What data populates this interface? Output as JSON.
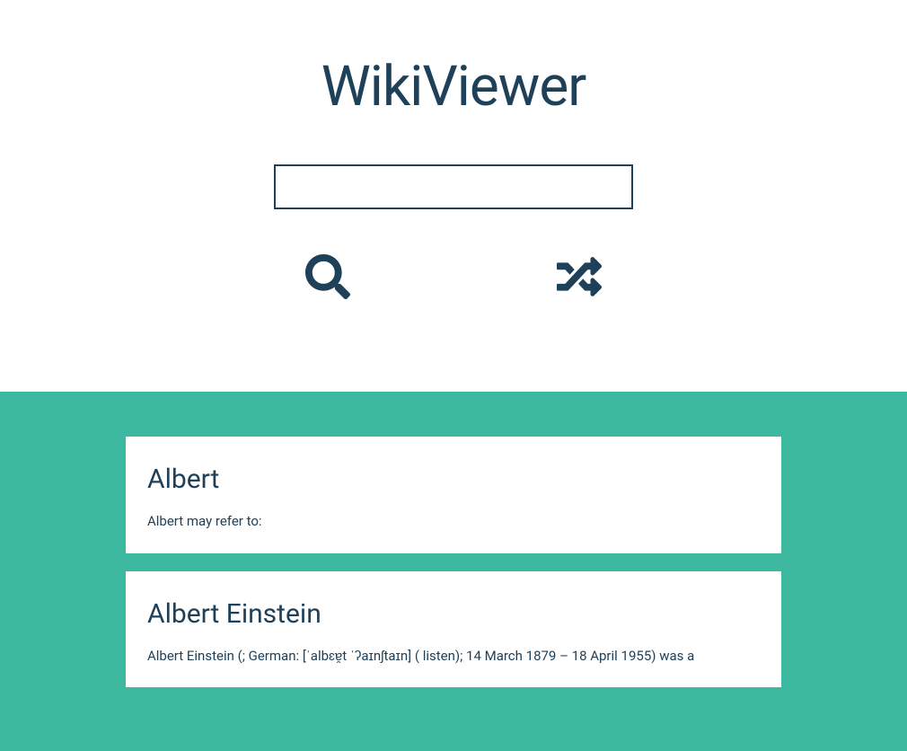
{
  "header": {
    "title": "WikiViewer"
  },
  "search": {
    "value": "",
    "placeholder": ""
  },
  "icons": {
    "search": "search-icon",
    "random": "shuffle-icon"
  },
  "results": [
    {
      "title": "Albert",
      "snippet": "Albert may refer to:"
    },
    {
      "title": "Albert Einstein",
      "snippet": "Albert Einstein (; German: [ˈalbɛɐ̯t ˈʔaɪnʃtaɪn] ( listen); 14 March 1879 – 18 April 1955) was a"
    }
  ],
  "colors": {
    "primary": "#1f4059",
    "accent": "#3db9a0",
    "card": "#ffffff"
  }
}
